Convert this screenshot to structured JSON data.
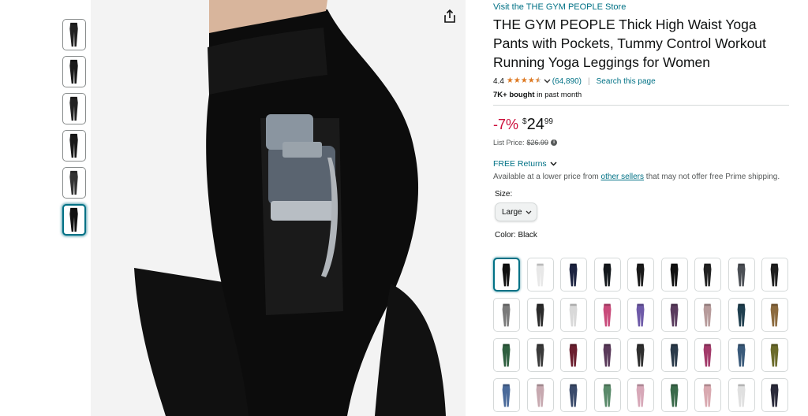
{
  "product": {
    "store_link": "Visit the THE GYM PEOPLE Store",
    "title": "THE GYM PEOPLE Thick High Waist Yoga Pants with Pockets, Tummy Control Workout Running Yoga Leggings for Women",
    "rating": "4.4",
    "rating_count": "(64,890)",
    "search_page": "Search this page",
    "bought_bold": "7K+ bought",
    "bought_rest": " in past month"
  },
  "price": {
    "discount": "-7%",
    "symbol": "$",
    "whole": "24",
    "fraction": "99",
    "list_label": "List Price:",
    "list_value": "$26.99"
  },
  "returns": {
    "label": "FREE Returns"
  },
  "availability": {
    "prefix": "Available at a lower price from ",
    "link": "other sellers",
    "suffix": " that may not offer free Prime shipping."
  },
  "size": {
    "label": "Size:",
    "selected": "Large"
  },
  "color": {
    "label": "Color:",
    "selected": "Black"
  },
  "icons": {
    "share": "share-icon",
    "info": "info-icon",
    "chevron": "chevron-down-icon"
  },
  "colors": {
    "link": "#007185",
    "discount": "#cc0c39",
    "star": "#de7921"
  },
  "thumbnails": [
    "#222222",
    "#1a1a1a",
    "#222222",
    "#1a1a1a",
    "#333333",
    "#111111"
  ],
  "swatches": [
    "#111111",
    "#e8e8e8",
    "#1c2340",
    "#14181c",
    "#1a1a1a",
    "#111111",
    "#222222",
    "#4b4f55",
    "#1f1f1f",
    "#7a7a7a",
    "#2b2b2b",
    "#d9d9d9",
    "#c94b7b",
    "#6e5aa8",
    "#5a3b5e",
    "#b79b9b",
    "#1f3f4f",
    "#8b6a3e",
    "#2f5f3f",
    "#3a3a3a",
    "#6b1f2f",
    "#5a3a5a",
    "#2f2f2f",
    "#2a3a4a",
    "#a33a6a",
    "#3a5a7a",
    "#6b6b2a",
    "#4a6a9a",
    "#c7a9b0",
    "#3a4a6a",
    "#5a8a6a",
    "#d7a8b8",
    "#3a6a4a",
    "#d9a9b0",
    "#e0e0e0",
    "#2a2a3a"
  ]
}
